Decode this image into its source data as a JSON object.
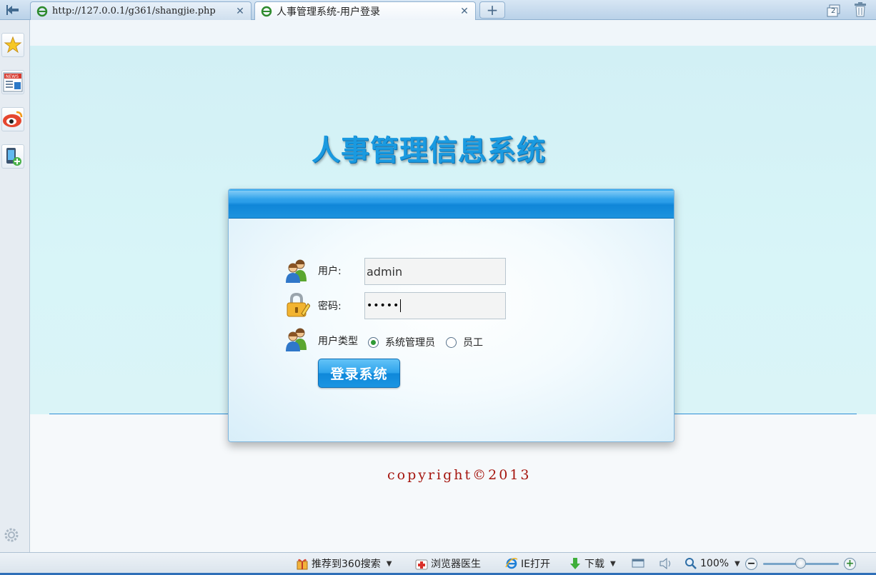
{
  "browser": {
    "tabs": [
      {
        "title": "http://127.0.0.1/g361/shangjie.php"
      },
      {
        "title": "人事管理系统-用户登录"
      }
    ],
    "new_tab_symbol": "+",
    "trash_badge": "2"
  },
  "page": {
    "heading": "人事管理信息系统",
    "form": {
      "user_label": "用户:",
      "user_value": "admin",
      "password_label": "密码:",
      "password_value": "•••••",
      "type_label": "用户类型",
      "options": [
        "系统管理员",
        "员工"
      ],
      "selected_option": "系统管理员",
      "submit_label": "登录系统"
    },
    "copyright": "copyright©2013"
  },
  "statusbar": {
    "recommend": "推荐到360搜索",
    "doctor": "浏览器医生",
    "ie_open": "IE打开",
    "download": "下载",
    "zoom": "100%"
  },
  "colors": {
    "accent": "#1a9ae0",
    "copyright": "#a5160f"
  },
  "icons": [
    "back-icon",
    "ie-favicon",
    "close-icon",
    "plus-icon",
    "restore-window-icon",
    "trash-icon",
    "star-icon",
    "news-icon",
    "weibo-icon",
    "mobile-add-icon",
    "gear-icon",
    "users-icon",
    "lock-icon",
    "gift-icon",
    "medkit-icon",
    "ie-icon",
    "download-arrow-icon",
    "window-icon",
    "speaker-icon",
    "magnifier-icon"
  ]
}
